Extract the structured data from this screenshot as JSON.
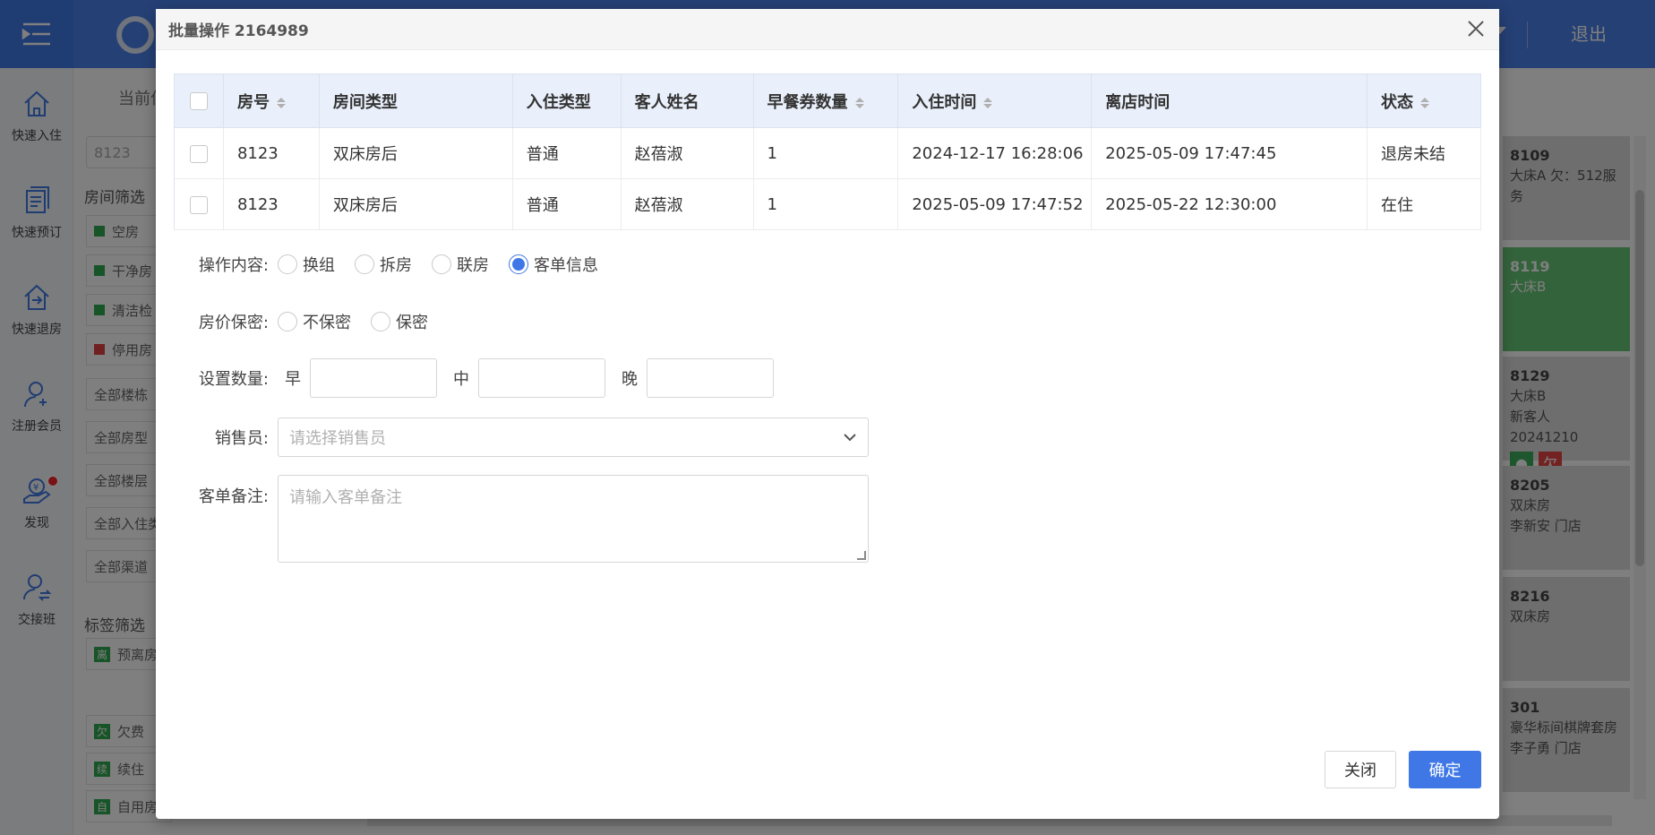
{
  "nav": {
    "items": [
      {
        "label": "快速入住"
      },
      {
        "label": "快速预订"
      },
      {
        "label": "快速退房"
      },
      {
        "label": "注册会员"
      },
      {
        "label": "发现"
      },
      {
        "label": "交接班"
      }
    ]
  },
  "header": {
    "logout": "退出"
  },
  "background": {
    "crumb": "当前位",
    "search_value": "8123",
    "room_filter_title": "房间筛选",
    "room_filters": [
      {
        "label": "空房",
        "color": "#2fa84f"
      },
      {
        "label": "干净房",
        "color": "#2fa84f"
      },
      {
        "label": "清洁检",
        "color": "#2fa84f"
      },
      {
        "label": "停用房",
        "color": "#e04040"
      }
    ],
    "dropdown_filters": [
      "全部楼栋",
      "全部房型",
      "全部楼层",
      "全部入住类",
      "全部渠道"
    ],
    "tag_filter_title": "标签筛选",
    "tag_filters": [
      {
        "tag": "离",
        "label": "预离房"
      },
      {
        "tag": "欠",
        "label": "欠费"
      },
      {
        "tag": "续",
        "label": "续住"
      },
      {
        "tag": "自",
        "label": "自用房"
      }
    ],
    "rooms": [
      {
        "no": "8109",
        "lines": [
          "大床A 欠：512服务"
        ]
      },
      {
        "no": "8119",
        "lines": [
          "大床B"
        ]
      },
      {
        "no": "8129",
        "lines": [
          "大床B",
          "新客人 20241210"
        ]
      },
      {
        "no": "8205",
        "lines": [
          "双床房",
          "李新安 门店"
        ]
      },
      {
        "no": "8216",
        "lines": [
          "双床房"
        ]
      },
      {
        "no": "301",
        "lines": [
          "豪华标间棋牌套房",
          "李子勇 门店"
        ]
      }
    ]
  },
  "modal": {
    "title": "批量操作 2164989",
    "table": {
      "headers": [
        "房号",
        "房间类型",
        "入住类型",
        "客人姓名",
        "早餐券数量",
        "入住时间",
        "离店时间",
        "状态"
      ],
      "rows": [
        [
          "8123",
          "双床房后",
          "普通",
          "赵蓓淑",
          "1",
          "2024-12-17 16:28:06",
          "2025-05-09 17:47:45",
          "退房未结"
        ],
        [
          "8123",
          "双床房后",
          "普通",
          "赵蓓淑",
          "1",
          "2025-05-09 17:47:52",
          "2025-05-22 12:30:00",
          "在住"
        ]
      ]
    },
    "operation": {
      "label": "操作内容:",
      "options": [
        "换组",
        "拆房",
        "联房",
        "客单信息"
      ],
      "selected": "客单信息"
    },
    "price_secret": {
      "label": "房价保密:",
      "options": [
        "不保密",
        "保密"
      ]
    },
    "quantity": {
      "label": "设置数量:",
      "fields": [
        "早",
        "中",
        "晚"
      ]
    },
    "salesperson": {
      "label": "销售员:",
      "placeholder": "请选择销售员"
    },
    "remark": {
      "label": "客单备注:",
      "placeholder": "请输入客单备注"
    },
    "buttons": {
      "close": "关闭",
      "ok": "确定"
    }
  }
}
